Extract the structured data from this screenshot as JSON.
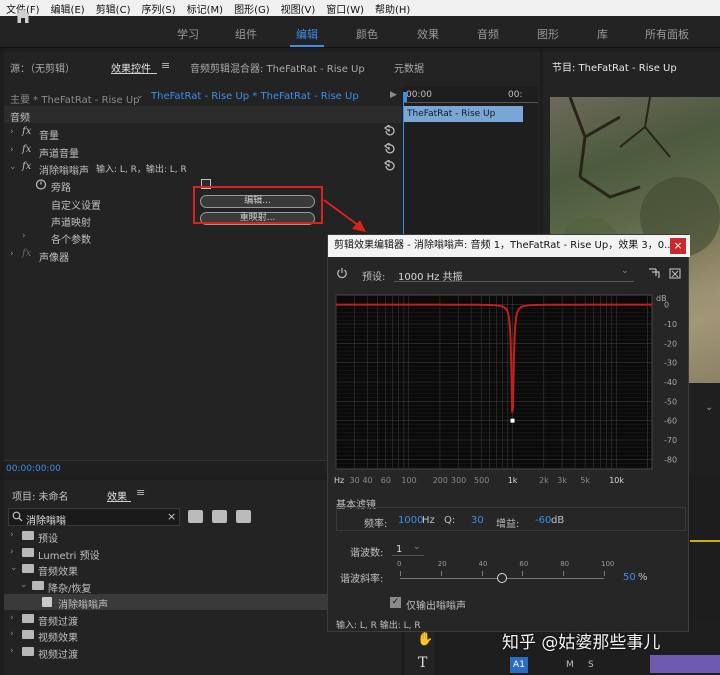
{
  "menu": [
    "文件(F)",
    "编辑(E)",
    "剪辑(C)",
    "序列(S)",
    "标记(M)",
    "图形(G)",
    "视图(V)",
    "窗口(W)",
    "帮助(H)"
  ],
  "workspaces": [
    "学习",
    "组件",
    "编辑",
    "颜色",
    "效果",
    "音频",
    "图形",
    "库",
    "所有面板"
  ],
  "workspace_active": "编辑",
  "source_tabs": {
    "source": "源：（无剪辑）",
    "effect_controls": "效果控件",
    "mixer": "音频剪辑混合器: TheFatRat - Rise Up",
    "metadata": "元数据"
  },
  "program_title": "节目: TheFatRat - Rise Up",
  "effect_controls": {
    "master_clip": "主要 * TheFatRat - Rise Up",
    "sequence_clip": "TheFatRat - Rise Up * TheFatRat - Rise Up",
    "time_start": "00:00",
    "time_end": "00:",
    "clip_bar": "TheFatRat - Rise Up",
    "section_audio": "音频",
    "volume": "音量",
    "channel_volume": "声道音量",
    "hum_effect": "消除嗡嗡声",
    "hum_io": "输入: L, R，输出: L, R",
    "bypass": "旁路",
    "custom_setup": "自定义设置",
    "channel_map": "声道映射",
    "params": "各个参数",
    "panner": "声像器",
    "edit_btn": "编辑...",
    "remap_btn": "重映射...",
    "timecode": "00:00:00:00"
  },
  "project": {
    "tab_project": "项目: 未命名",
    "tab_effects": "效果",
    "search_value": "消除嗡嗡",
    "tree": [
      {
        "label": "预设",
        "level": 0,
        "open": false
      },
      {
        "label": "Lumetri 预设",
        "level": 0,
        "open": false
      },
      {
        "label": "音频效果",
        "level": 0,
        "open": true
      },
      {
        "label": "降杂/恢复",
        "level": 1,
        "open": true
      },
      {
        "label": "消除嗡嗡声",
        "level": 2,
        "open": false,
        "selected": true
      },
      {
        "label": "音频过渡",
        "level": 0,
        "open": false
      },
      {
        "label": "视频效果",
        "level": 0,
        "open": false
      },
      {
        "label": "视频过渡",
        "level": 0,
        "open": false
      }
    ]
  },
  "dialog": {
    "title": "剪辑效果编辑器 - 消除嗡嗡声: 音频 1，TheFatRat - Rise Up，效果 3，0...",
    "close": "×",
    "preset_label": "预设:",
    "preset_value": "1000 Hz 共振",
    "db_unit": "dB",
    "db_ticks": [
      "0",
      "-10",
      "-20",
      "-30",
      "-40",
      "-50",
      "-60",
      "-70",
      "-80"
    ],
    "hz_ticks": [
      "Hz",
      "30",
      "40",
      "60",
      "100",
      "200",
      "300",
      "500",
      "1k",
      "2k",
      "3k",
      "5k",
      "10k"
    ],
    "basic_filter": "基本滤镜",
    "freq_label": "频率:",
    "freq_value": "1000",
    "freq_unit": "Hz",
    "q_label": "Q:",
    "q_value": "30",
    "gain_label": "增益:",
    "gain_value": "-60",
    "gain_unit": "dB",
    "harmonics_label": "谐波数:",
    "harmonics_value": "1",
    "slope_label": "谐波斜率:",
    "slope_ticks": [
      "0",
      "20",
      "40",
      "60",
      "80",
      "100"
    ],
    "slope_value": "50",
    "slope_unit": "%",
    "slope_level": 0.5,
    "output_only_label": "仅输出嗡嗡声",
    "output_only_checked": true,
    "io_text": "输入: L, R     输出: L, R"
  },
  "watermark": "知乎 @姑婆那些事儿",
  "timeline": {
    "a1": "A1",
    "m": "M",
    "s": "S"
  },
  "colors": {
    "accent": "#3d8ee8",
    "annotation_red": "#d9231f",
    "curve_red": "#c2201c"
  }
}
